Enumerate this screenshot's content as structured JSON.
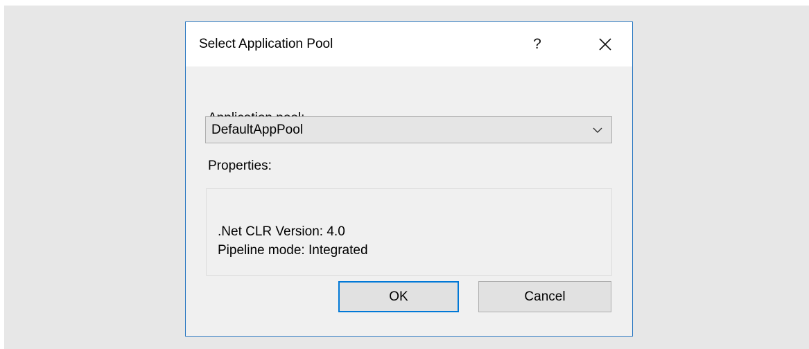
{
  "dialog": {
    "title": "Select Application Pool",
    "help_glyph": "?",
    "close_glyph_name": "close-icon",
    "accent_color": "#2b79c2"
  },
  "pool": {
    "label_prefix": "App",
    "label_mnemonic": "l",
    "label_suffix": "ication pool:",
    "selected_value": "DefaultAppPool",
    "arrow_icon": "chevron-down-icon"
  },
  "properties": {
    "label": "Properties:",
    "clr_version": ".Net CLR Version: 4.0",
    "pipeline_mode": "Pipeline mode: Integrated"
  },
  "buttons": {
    "ok_label": "OK",
    "cancel_label": "Cancel"
  }
}
